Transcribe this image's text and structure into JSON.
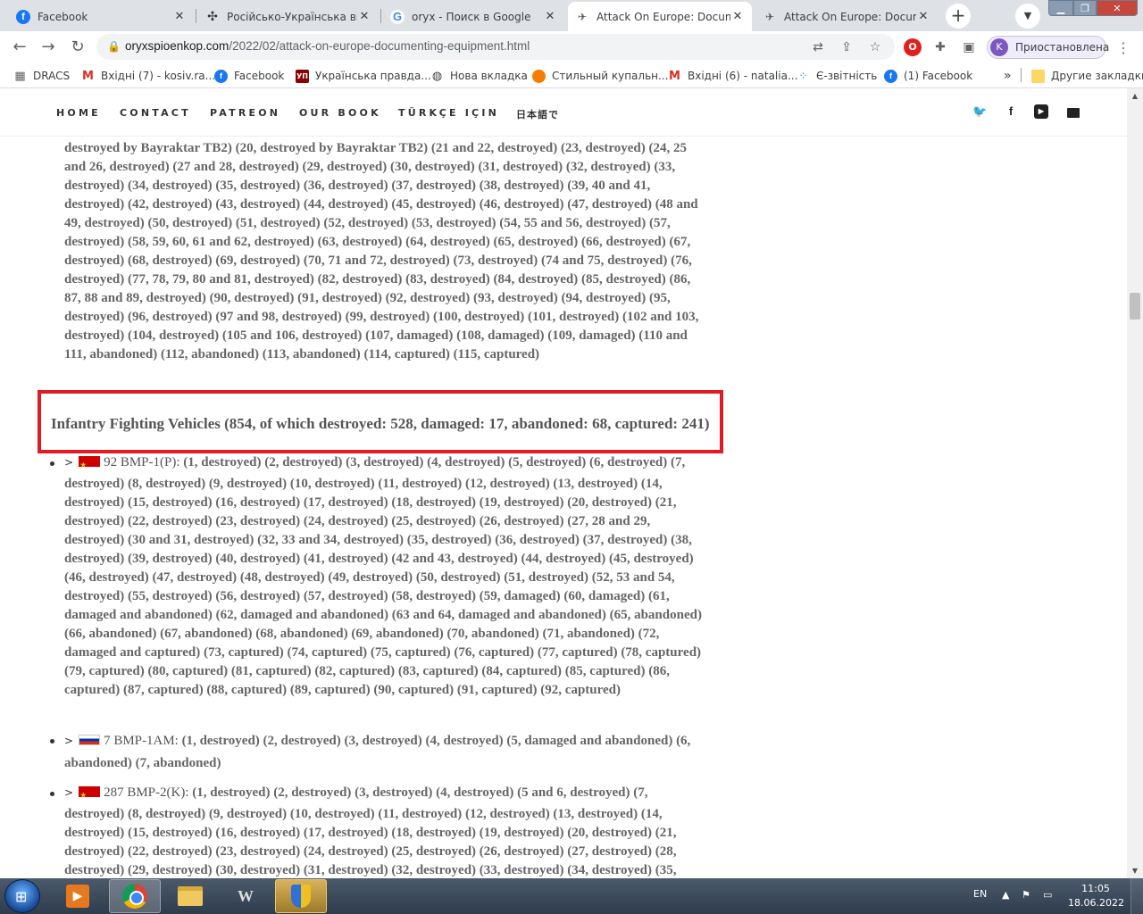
{
  "browser": {
    "tabs": [
      {
        "title": "Facebook",
        "icon": "facebook-icon",
        "active": false
      },
      {
        "title": "Російсько-Українська війн",
        "icon": "trident-icon",
        "active": false
      },
      {
        "title": "oryx - Поиск в Google",
        "icon": "google-icon",
        "active": false
      },
      {
        "title": "Attack On Europe: Docume",
        "icon": "oryx-icon",
        "active": true
      },
      {
        "title": "Attack On Europe: Docume",
        "icon": "oryx-icon",
        "active": false
      }
    ],
    "url_host": "oryxspioenkop.com",
    "url_path": "/2022/02/attack-on-europe-documenting-equipment.html",
    "profile_initial": "K",
    "profile_label": "Приостановлена",
    "bookmarks": [
      {
        "label": "DRACS",
        "icon": "docs-icon"
      },
      {
        "label": "Вхідні (7) - kosiv.ra...",
        "icon": "gmail-icon"
      },
      {
        "label": "Facebook",
        "icon": "facebook-icon"
      },
      {
        "label": "Українська правда...",
        "icon": "up-icon"
      },
      {
        "label": "Нова вкладка",
        "icon": "globe-icon"
      },
      {
        "label": "Стильный купальн...",
        "icon": "orange-circle-icon"
      },
      {
        "label": "Вхідні (6) - natalia...",
        "icon": "gmail-icon"
      },
      {
        "label": "Є-звітність",
        "icon": "e-report-icon"
      },
      {
        "label": "(1) Facebook",
        "icon": "facebook-icon"
      }
    ],
    "bookmarks_more": "»",
    "other_bookmarks": "Другие закладки"
  },
  "site": {
    "nav": [
      "HOME",
      "CONTACT",
      "PATREON",
      "OUR BOOK",
      "TÜRKÇE IÇIN",
      "日本語で"
    ],
    "social_icons": [
      "twitter-icon",
      "facebook-icon",
      "youtube-icon",
      "mail-icon"
    ]
  },
  "article": {
    "preceding_paragraph": "destroyed by Bayraktar TB2) (20, destroyed by Bayraktar TB2) (21 and 22, destroyed) (23, destroyed) (24, 25 and 26, destroyed) (27 and 28, destroyed) (29, destroyed) (30, destroyed) (31, destroyed) (32, destroyed) (33, destroyed) (34, destroyed) (35, destroyed) (36, destroyed) (37, destroyed) (38, destroyed) (39, 40 and 41, destroyed) (42, destroyed) (43, destroyed) (44, destroyed) (45, destroyed) (46, destroyed) (47, destroyed) (48 and 49, destroyed) (50, destroyed) (51, destroyed) (52, destroyed) (53, destroyed) (54, 55 and 56, destroyed) (57, destroyed) (58, 59, 60, 61 and 62, destroyed) (63, destroyed) (64, destroyed) (65, destroyed) (66, destroyed) (67, destroyed) (68, destroyed) (69, destroyed) (70, 71 and 72, destroyed) (73, destroyed) (74 and 75, destroyed) (76, destroyed) (77, 78, 79, 80 and 81, destroyed) (82, destroyed) (83, destroyed) (84, destroyed) (85, destroyed) (86, 87, 88 and 89, destroyed) (90, destroyed) (91, destroyed) (92, destroyed) (93, destroyed) (94, destroyed) (95, destroyed) (96, destroyed) (97 and 98, destroyed) (99, destroyed) (100, destroyed) (101, destroyed) (102 and 103, destroyed) (104, destroyed) (105 and 106, destroyed) (107, damaged) (108, damaged) (109, damaged) (110 and 111, abandoned) (112, abandoned) (113, abandoned) (114, captured) (115, captured)",
    "heading": "Infantry Fighting Vehicles (854, of which destroyed: 528, damaged: 17, abandoned: 68, captured: 241)",
    "items": [
      {
        "chevron": ">",
        "flag": "soviet-flag-icon",
        "name": "92 BMP-1(P):",
        "first_line": "(1, destroyed) (2, destroyed) (3, destroyed) (4, destroyed) (5, destroyed) (6, destroyed) (7,",
        "rest": "destroyed) (8, destroyed) (9, destroyed) (10, destroyed) (11, destroyed) (12, destroyed) (13, destroyed) (14, destroyed) (15, destroyed) (16, destroyed) (17, destroyed) (18, destroyed) (19, destroyed) (20, destroyed) (21, destroyed) (22, destroyed) (23, destroyed) (24, destroyed) (25, destroyed) (26, destroyed) (27, 28 and 29, destroyed) (30 and 31, destroyed) (32, 33 and 34, destroyed) (35, destroyed) (36, destroyed) (37, destroyed) (38, destroyed) (39, destroyed) (40, destroyed) (41, destroyed) (42 and 43, destroyed) (44, destroyed) (45, destroyed) (46, destroyed) (47, destroyed) (48, destroyed) (49, destroyed) (50, destroyed) (51, destroyed) (52, 53 and 54, destroyed) (55, destroyed) (56, destroyed) (57, destroyed) (58, destroyed) (59, damaged) (60, damaged) (61, damaged and abandoned) (62, damaged and abandoned) (63 and 64, damaged and abandoned) (65, abandoned) (66, abandoned) (67, abandoned) (68, abandoned) (69, abandoned) (70, abandoned) (71, abandoned) (72, damaged and captured) (73, captured) (74, captured) (75, captured) (76, captured) (77, captured) (78, captured) (79, captured) (80, captured) (81, captured) (82, captured) (83, captured) (84, captured) (85, captured) (86, captured) (87, captured) (88, captured) (89, captured) (90, captured) (91, captured) (92, captured)"
      },
      {
        "chevron": ">",
        "flag": "russian-flag-icon",
        "name": "7 BMP-1AM:",
        "first_line": "(1, destroyed) (2, destroyed) (3, destroyed) (4, destroyed) (5, damaged and abandoned) (6,",
        "rest": "abandoned) (7, abandoned)"
      },
      {
        "chevron": ">",
        "flag": "soviet-flag-icon",
        "name": "287 BMP-2(K):",
        "first_line": "(1, destroyed) (2, destroyed) (3, destroyed) (4, destroyed) (5 and 6, destroyed) (7,",
        "rest": "destroyed) (8, destroyed) (9, destroyed) (10, destroyed) (11, destroyed) (12, destroyed) (13, destroyed) (14, destroyed) (15, destroyed) (16, destroyed) (17, destroyed) (18, destroyed) (19, destroyed) (20, destroyed) (21, destroyed) (22, destroyed) (23, destroyed) (24, destroyed) (25, destroyed) (26, destroyed) (27, destroyed) (28, destroyed) (29, destroyed) (30, destroyed) (31, destroyed) (32, destroyed) (33, destroyed) (34, destroyed) (35,"
      }
    ]
  },
  "taskbar": {
    "language": "EN",
    "time": "11:05",
    "date": "18.06.2022"
  },
  "colors": {
    "highlight_border": "#e01b24",
    "tab_strip": "#dee1e6",
    "body_text": "#666666"
  }
}
